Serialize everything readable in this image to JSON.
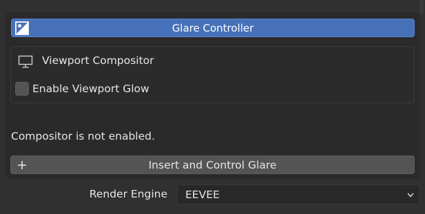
{
  "panel": {
    "header_button_label": "Glare Controller",
    "header_icon": "image-icon",
    "viewport_compositor": {
      "icon": "monitor-icon",
      "label": "Viewport Compositor"
    },
    "enable_viewport_glow": {
      "label": "Enable Viewport Glow",
      "checked": false
    },
    "status_message": "Compositor is not enabled.",
    "insert_button": {
      "icon": "plus-icon",
      "label": "Insert and Control Glare"
    }
  },
  "render_engine": {
    "label": "Render Engine",
    "value": "EEVEE",
    "icon": "chevron-down-icon"
  },
  "colors": {
    "background": "#303030",
    "panel": "#2a2a2a",
    "accent": "#4671b8",
    "button": "#545454",
    "text": "#e6e6e6"
  }
}
